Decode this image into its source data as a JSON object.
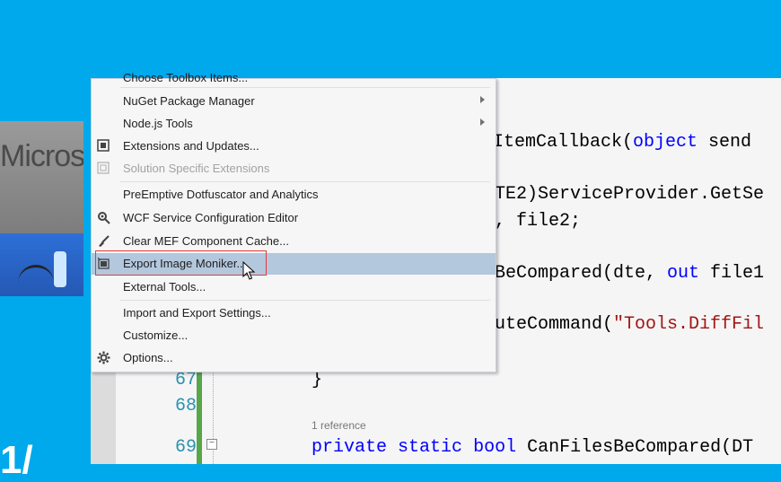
{
  "inset": {
    "logo_text": "Micros"
  },
  "bottom_glyph": "1/",
  "editor": {
    "line_numbers": [
      "67",
      "68",
      "69"
    ],
    "code": {
      "line1_frag": "uItemCallback(",
      "line1_kw": "object",
      "line1_tail": " send",
      "line2_frag": "TE2)ServiceProvider.GetSe",
      "line3_frag": ", file2;",
      "line4_frag": "BeCompared(dte, ",
      "line4_kw": "out",
      "line4_tail": " file1",
      "line5_frag": "uteCommand(",
      "line5_str": "\"Tools.DiffFil",
      "brace": "}",
      "reference": "1 reference",
      "sig_kw1": "private",
      "sig_kw2": "static",
      "sig_kw3": "bool",
      "sig_name": " CanFilesBeCompared(DT"
    }
  },
  "menu": {
    "partial_top": "Choose Toolbox Items...",
    "items": [
      {
        "label": "NuGet Package Manager",
        "submenu": true,
        "icon": ""
      },
      {
        "label": "Node.js Tools",
        "submenu": true,
        "icon": ""
      },
      {
        "label": "Extensions and Updates...",
        "icon": "extensions-icon"
      },
      {
        "label": "Solution Specific Extensions",
        "disabled": true,
        "icon": "solution-extensions-icon"
      },
      {
        "label": "PreEmptive Dotfuscator and Analytics",
        "icon": ""
      },
      {
        "label": "WCF Service Configuration Editor",
        "icon": "wcf-config-icon"
      },
      {
        "label": "Clear MEF Component Cache...",
        "icon": "broom-icon"
      },
      {
        "label": "Export Image Moniker...",
        "icon": "image-moniker-icon",
        "highlighted": true
      },
      {
        "label": "External Tools...",
        "icon": ""
      },
      {
        "label": "Import and Export Settings...",
        "icon": ""
      },
      {
        "label": "Customize...",
        "icon": ""
      },
      {
        "label": "Options...",
        "icon": "gear-icon"
      }
    ]
  }
}
